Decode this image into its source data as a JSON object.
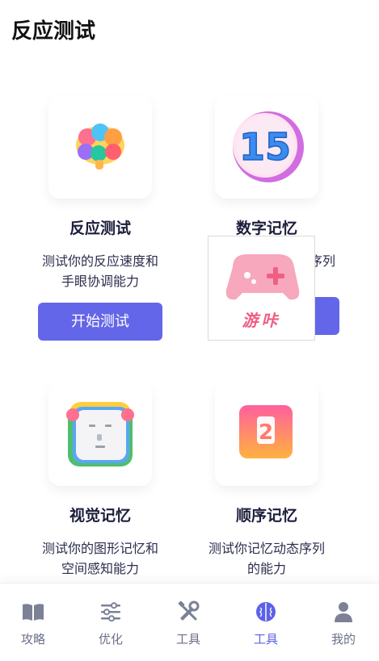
{
  "header": {
    "title": "反应测试"
  },
  "cards": [
    {
      "title": "反应测试",
      "desc_line1": "测试你的反应速度和",
      "desc_line2": "手眼协调能力",
      "button": "开始测试"
    },
    {
      "title": "数字记忆",
      "desc_line1": "序列",
      "desc_line2": "",
      "button": "",
      "badge_number": "15"
    },
    {
      "title": "视觉记忆",
      "desc_line1": "测试你的图形记忆和",
      "desc_line2": "空间感知能力"
    },
    {
      "title": "顺序记忆",
      "desc_line1": "测试你记忆动态序列",
      "desc_line2": "的能力",
      "badge_number": "2"
    }
  ],
  "overlay": {
    "text": "游咔"
  },
  "tabbar": {
    "items": [
      {
        "label": "攻略",
        "icon": "book-icon"
      },
      {
        "label": "优化",
        "icon": "sliders-icon"
      },
      {
        "label": "工具",
        "icon": "tools-icon"
      },
      {
        "label": "工具",
        "icon": "brain-icon",
        "active": true
      },
      {
        "label": "我的",
        "icon": "user-icon"
      }
    ]
  },
  "colors": {
    "accent": "#6366e8",
    "tab_active": "#5b61e8",
    "overlay_pink": "#ef5f83"
  }
}
